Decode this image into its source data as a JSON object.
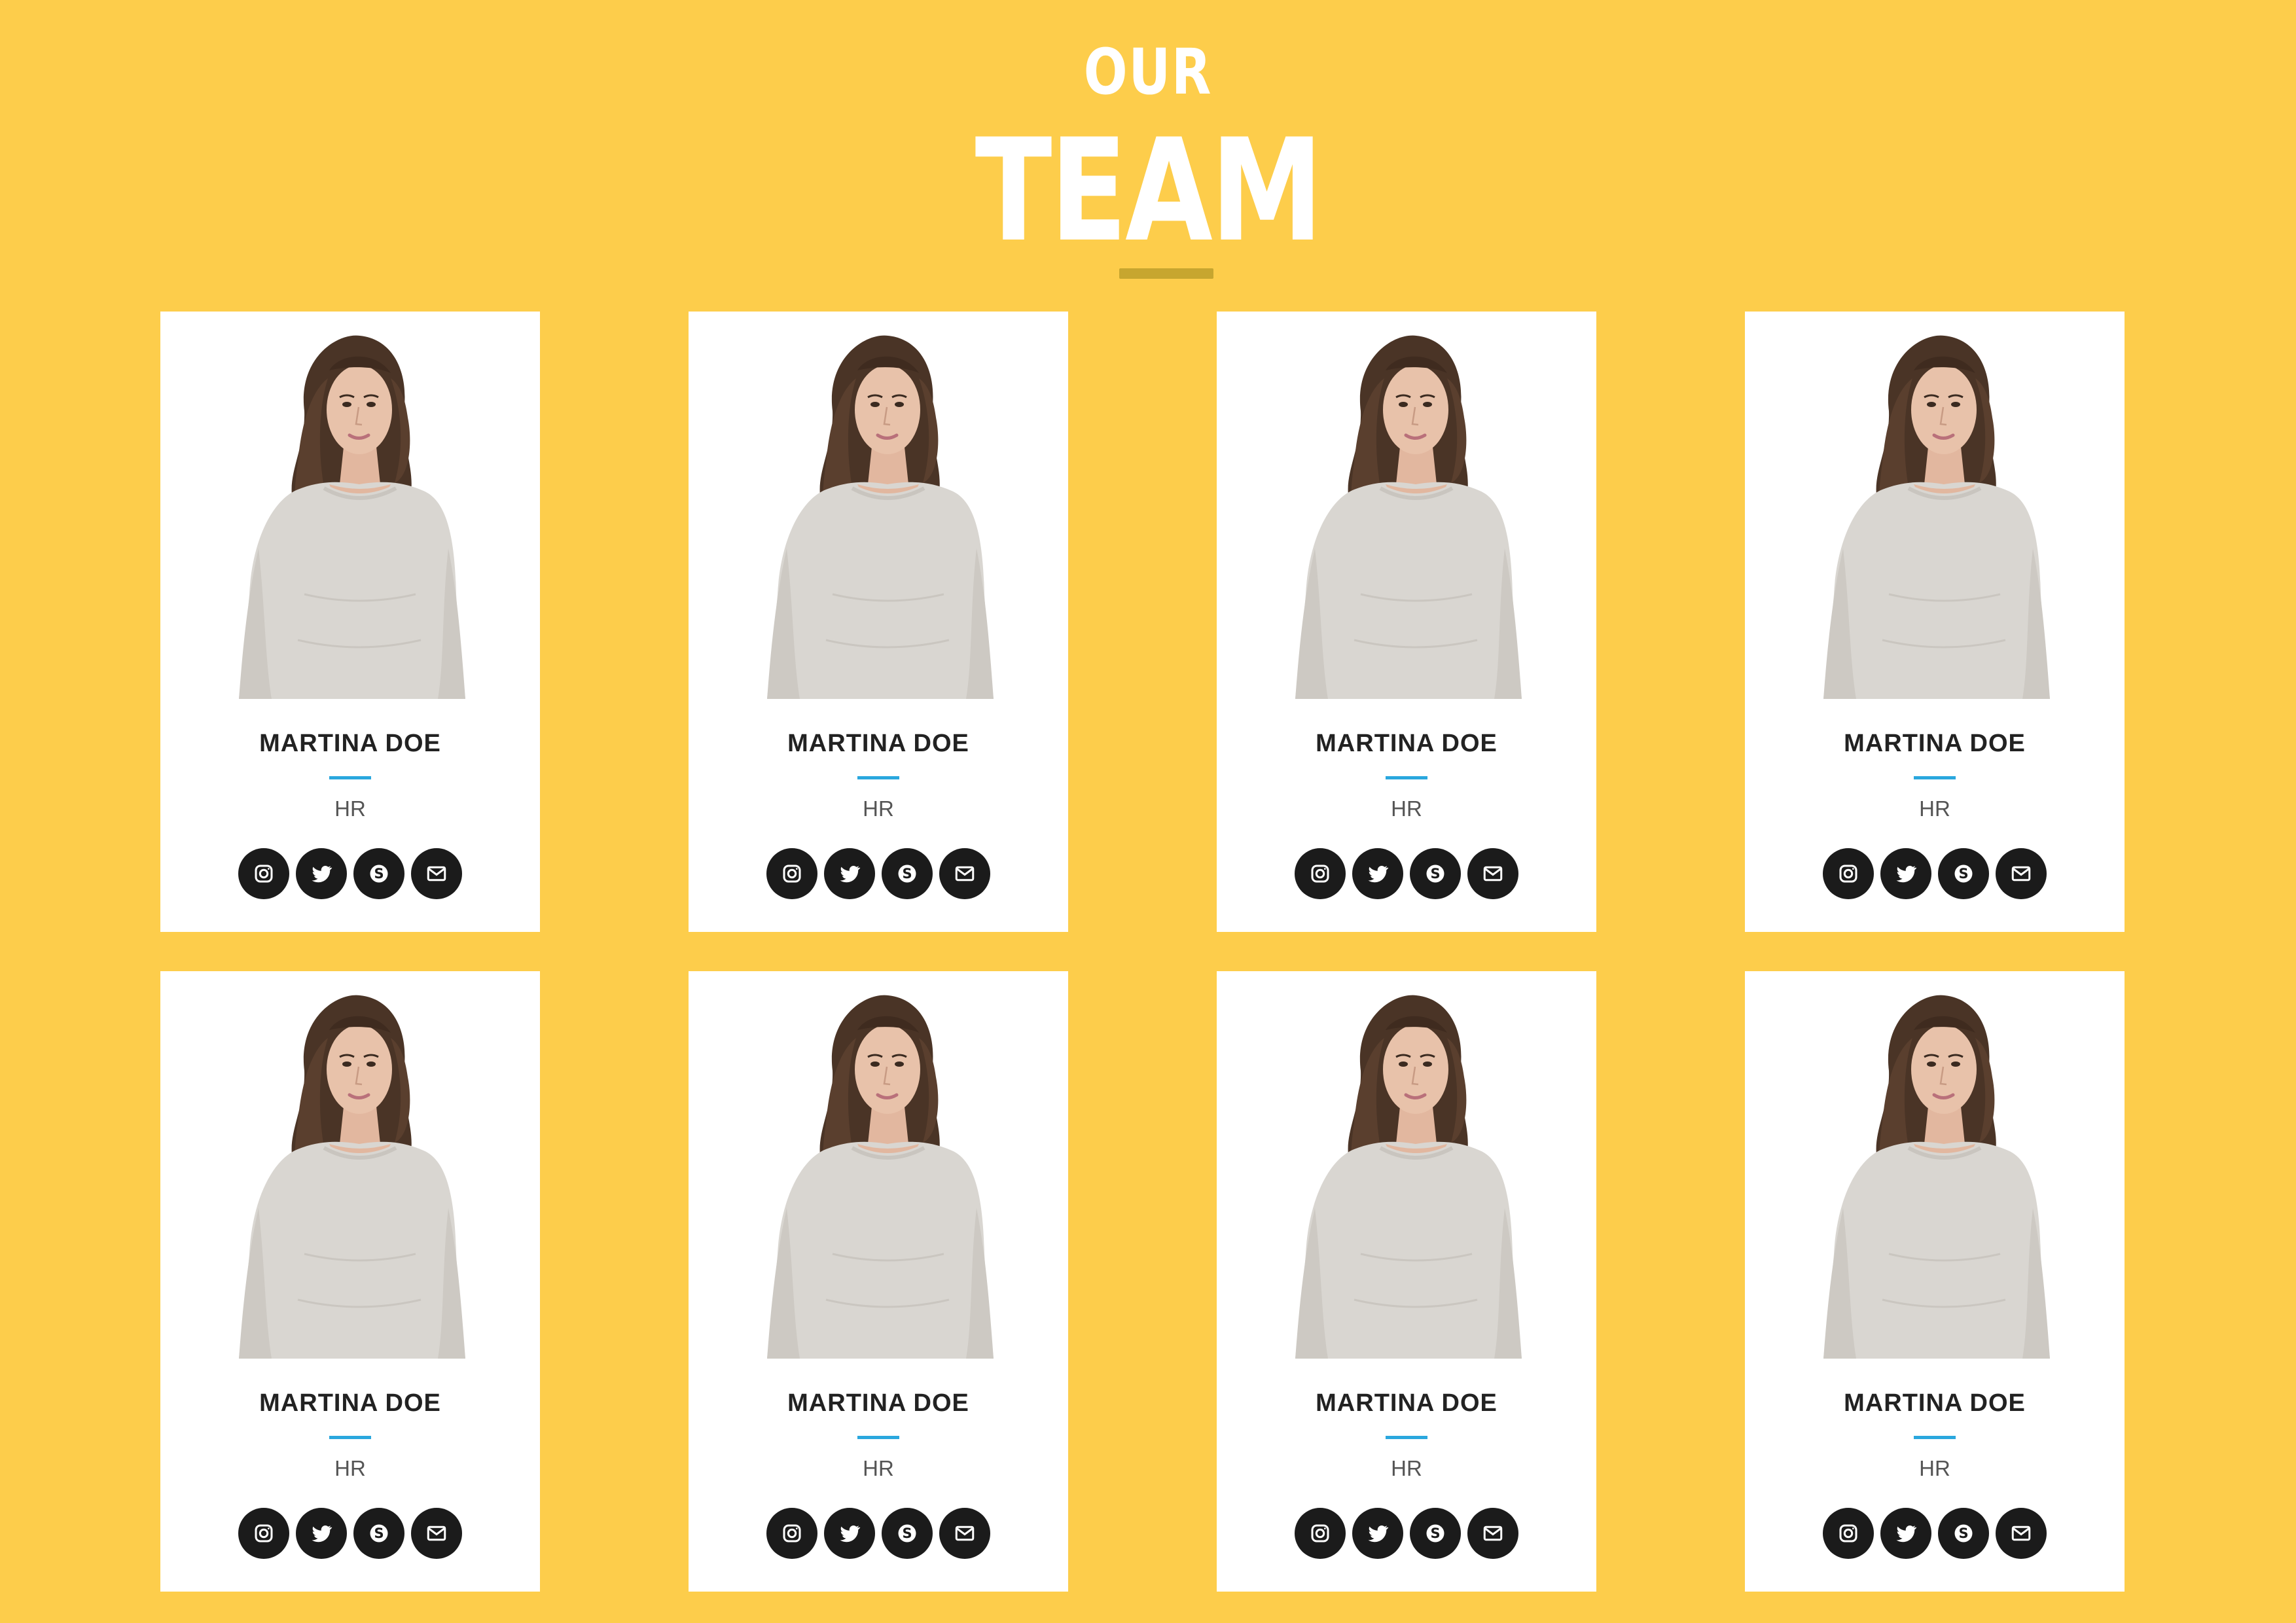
{
  "header": {
    "title_top": "OUR",
    "title_main": "TEAM"
  },
  "colors": {
    "background": "#FDCD4B",
    "card": "#FFFFFF",
    "accent_rule": "#2AA7DE",
    "title_bar": "#C7A62F",
    "icon_circle": "#1B1B1B"
  },
  "team": [
    {
      "name": "MARTINA DOE",
      "role": "HR"
    },
    {
      "name": "MARTINA DOE",
      "role": "HR"
    },
    {
      "name": "MARTINA DOE",
      "role": "HR"
    },
    {
      "name": "MARTINA DOE",
      "role": "HR"
    },
    {
      "name": "MARTINA DOE",
      "role": "HR"
    },
    {
      "name": "MARTINA DOE",
      "role": "HR"
    },
    {
      "name": "MARTINA DOE",
      "role": "HR"
    },
    {
      "name": "MARTINA DOE",
      "role": "HR"
    }
  ],
  "social_icons": [
    "instagram-icon",
    "twitter-icon",
    "skype-icon",
    "email-icon"
  ]
}
